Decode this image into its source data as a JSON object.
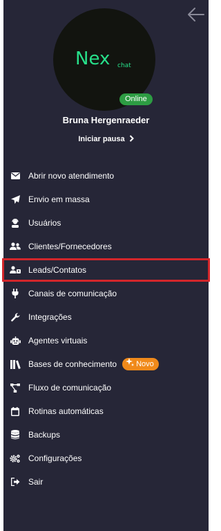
{
  "profile": {
    "logo_main": "Nex",
    "logo_sub": "chat",
    "status": "Online",
    "name": "Bruna Hergenraeder",
    "pause_label": "Iniciar pausa"
  },
  "menu": [
    {
      "label": "Abrir novo atendimento",
      "icon": "envelope-icon"
    },
    {
      "label": "Envio em massa",
      "icon": "paper-plane-icon"
    },
    {
      "label": "Usuários",
      "icon": "user-headset-icon"
    },
    {
      "label": "Clientes/Fornecedores",
      "icon": "users-icon"
    },
    {
      "label": "Leads/Contatos",
      "icon": "contacts-icon",
      "selected": true
    },
    {
      "label": "Canais de comunicação",
      "icon": "plug-icon"
    },
    {
      "label": "Integrações",
      "icon": "wrench-icon"
    },
    {
      "label": "Agentes virtuais",
      "icon": "robot-icon"
    },
    {
      "label": "Bases de conhecimento",
      "icon": "books-icon",
      "badge": "Novo"
    },
    {
      "label": "Fluxo de comunicação",
      "icon": "flow-icon"
    },
    {
      "label": "Rotinas automáticas",
      "icon": "calendar-icon"
    },
    {
      "label": "Backups",
      "icon": "database-icon"
    },
    {
      "label": "Configurações",
      "icon": "gears-icon"
    },
    {
      "label": "Sair",
      "icon": "sign-out-icon"
    }
  ],
  "colors": {
    "panel": "#262637",
    "logo": "#27e08a",
    "online": "#2d9c43",
    "new_badge": "#f08a1b",
    "selected_outline": "#d3262b"
  }
}
